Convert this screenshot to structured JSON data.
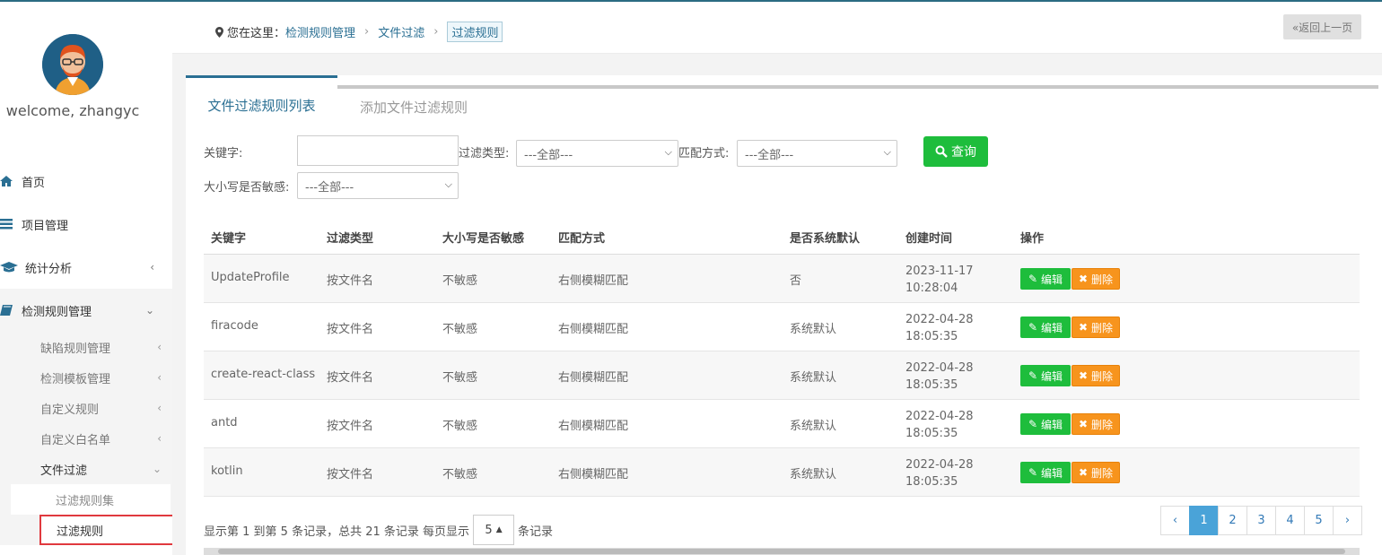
{
  "user": {
    "welcome": "welcome, zhangyc"
  },
  "nav": {
    "home": "首页",
    "project": "项目管理",
    "stats": "统计分析",
    "rules": "检测规则管理",
    "sub": {
      "defect": "缺陷规则管理",
      "template": "检测模板管理",
      "custom": "自定义规则",
      "whitelist": "自定义白名单",
      "filefilter": "文件过滤"
    },
    "leaf": {
      "ruleset": "过滤规则集",
      "rule": "过滤规则"
    }
  },
  "breadcrumb": {
    "prefix": "您在这里：",
    "l1": "检测规则管理",
    "l2": "文件过滤",
    "current": "过滤规则"
  },
  "back_label": "«返回上一页",
  "tabs": {
    "active": "文件过滤规则列表",
    "other": "添加文件过滤规则"
  },
  "filters": {
    "keyword_label": "关键字:",
    "type_label": "过滤类型:",
    "type_value": "---全部---",
    "match_label": "匹配方式:",
    "match_value": "---全部---",
    "case_label": "大小写是否敏感:",
    "case_value": "---全部---",
    "query_label": "查询"
  },
  "table": {
    "headers": [
      "关键字",
      "过滤类型",
      "大小写是否敏感",
      "匹配方式",
      "是否系统默认",
      "创建时间",
      "操作"
    ],
    "rows": [
      {
        "keyword": "UpdateProfile",
        "type": "按文件名",
        "case": "不敏感",
        "match": "右侧模糊匹配",
        "default": "否",
        "date": "2023-11-17",
        "time": "10:28:04"
      },
      {
        "keyword": "firacode",
        "type": "按文件名",
        "case": "不敏感",
        "match": "右侧模糊匹配",
        "default": "系统默认",
        "date": "2022-04-28",
        "time": "18:05:35"
      },
      {
        "keyword": "create-react-class",
        "type": "按文件名",
        "case": "不敏感",
        "match": "右侧模糊匹配",
        "default": "系统默认",
        "date": "2022-04-28",
        "time": "18:05:35"
      },
      {
        "keyword": "antd",
        "type": "按文件名",
        "case": "不敏感",
        "match": "右侧模糊匹配",
        "default": "系统默认",
        "date": "2022-04-28",
        "time": "18:05:35"
      },
      {
        "keyword": "kotlin",
        "type": "按文件名",
        "case": "不敏感",
        "match": "右侧模糊匹配",
        "default": "系统默认",
        "date": "2022-04-28",
        "time": "18:05:35"
      }
    ],
    "edit_label": "编辑",
    "delete_label": "删除"
  },
  "footer": {
    "summary": "显示第 1 到第 5 条记录，总共 21 条记录 每页显示",
    "page_size": "5",
    "suffix": "条记录"
  },
  "pager": {
    "prev": "‹",
    "pages": [
      "1",
      "2",
      "3",
      "4",
      "5"
    ],
    "next": "›"
  },
  "colors": {
    "accent": "#2a6f93",
    "green": "#1ebd3c",
    "orange": "#f7941d",
    "pager_active": "#4aa3d8"
  }
}
